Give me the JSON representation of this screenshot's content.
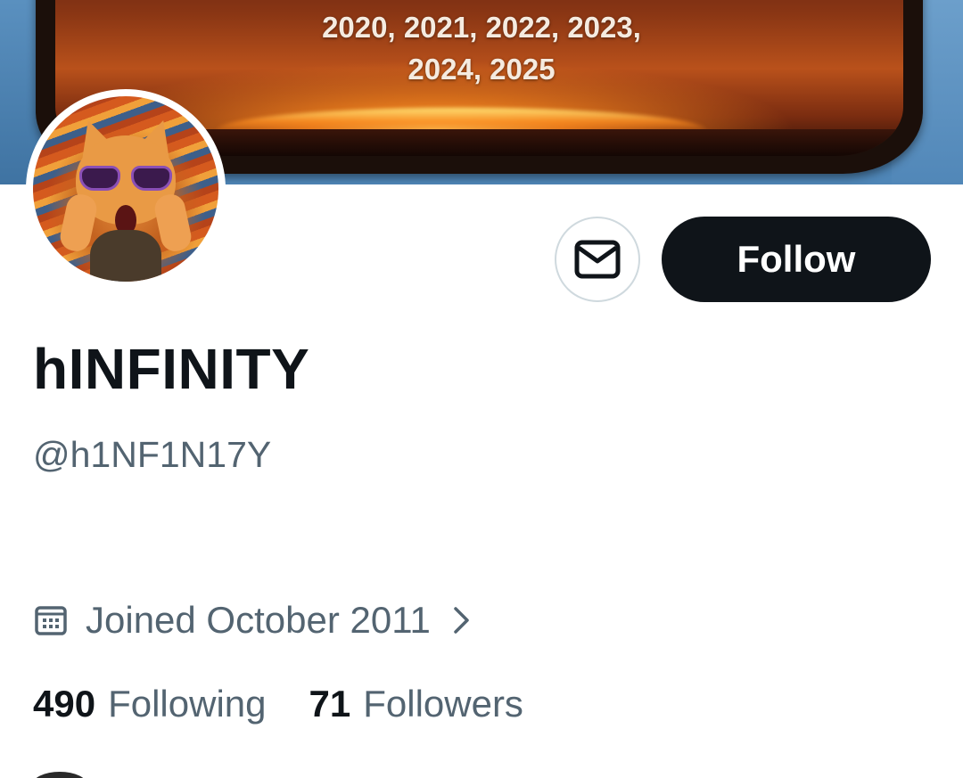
{
  "banner": {
    "line1": "2020, 2021, 2022, 2023,",
    "line2": "2024, 2025"
  },
  "profile": {
    "display_name": "hINFINITY",
    "handle": "@h1NF1N17Y",
    "joined": "Joined October 2011"
  },
  "actions": {
    "message_icon": "mail-icon",
    "follow_label": "Follow"
  },
  "stats": {
    "following_count": "490",
    "following_label": "Following",
    "followers_count": "71",
    "followers_label": "Followers"
  },
  "icons": {
    "calendar": "calendar-icon",
    "chevron": "chevron-right-icon"
  },
  "colors": {
    "text_primary": "#0f1419",
    "text_secondary": "#536471",
    "border": "#cfd9de",
    "follow_bg": "#0f1419"
  }
}
